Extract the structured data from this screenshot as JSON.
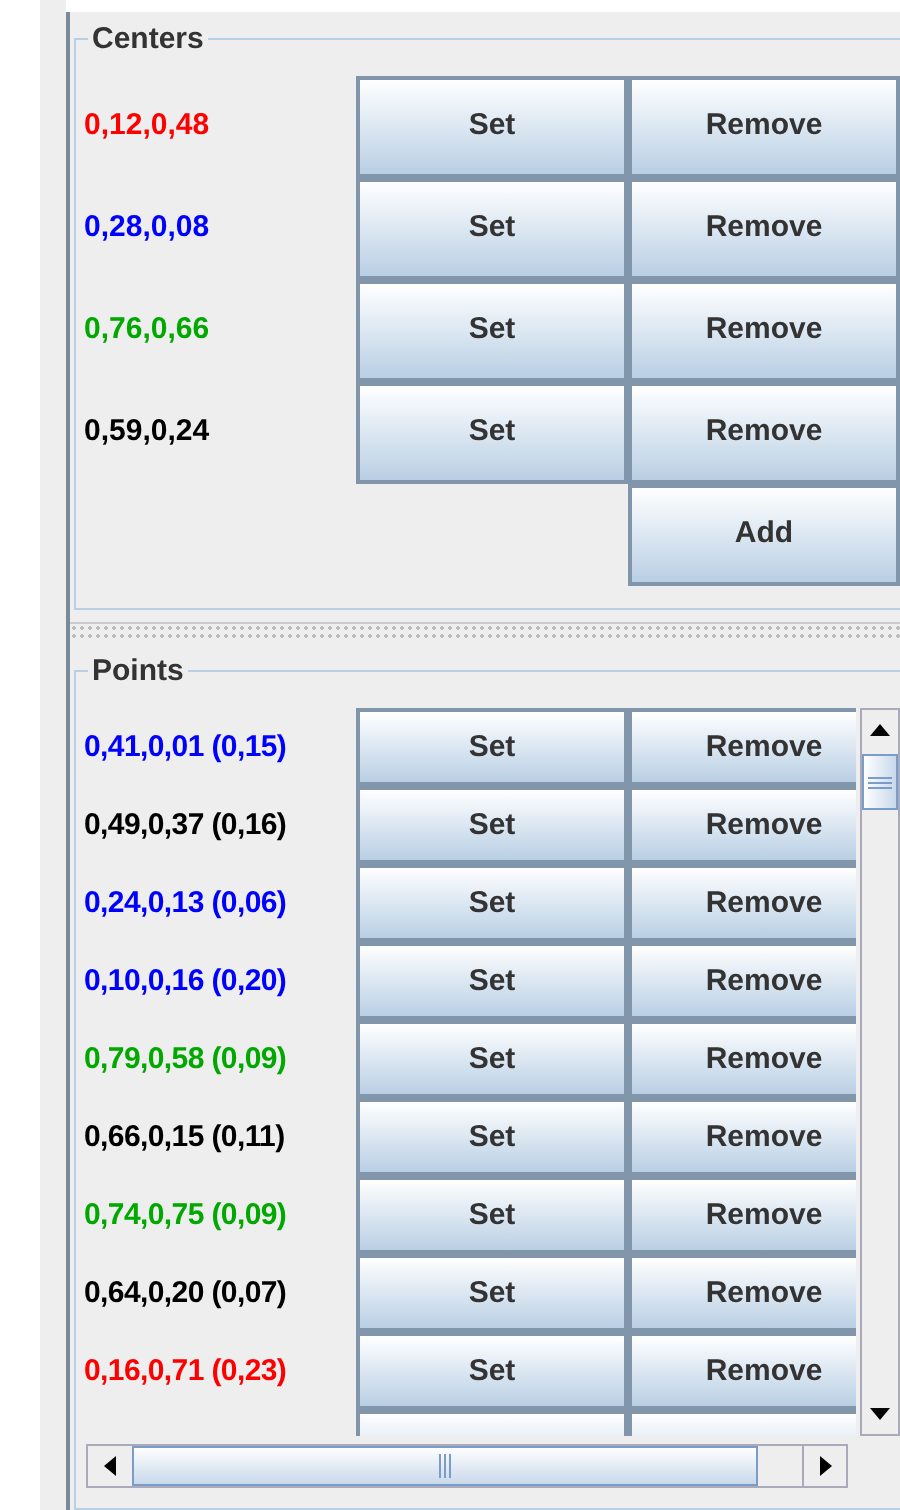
{
  "centers": {
    "title": "Centers",
    "items": [
      {
        "label": "0,12,0,48",
        "color": "#ff0000",
        "set": "Set",
        "remove": "Remove"
      },
      {
        "label": "0,28,0,08",
        "color": "#0000ff",
        "set": "Set",
        "remove": "Remove"
      },
      {
        "label": "0,76,0,66",
        "color": "#00a800",
        "set": "Set",
        "remove": "Remove"
      },
      {
        "label": "0,59,0,24",
        "color": "#000000",
        "set": "Set",
        "remove": "Remove"
      }
    ],
    "add": "Add"
  },
  "points": {
    "title": "Points",
    "items": [
      {
        "label": "0,41,0,01 (0,15)",
        "color": "#0000ff",
        "set": "Set",
        "remove": "Remove"
      },
      {
        "label": "0,49,0,37 (0,16)",
        "color": "#000000",
        "set": "Set",
        "remove": "Remove"
      },
      {
        "label": "0,24,0,13 (0,06)",
        "color": "#0000ff",
        "set": "Set",
        "remove": "Remove"
      },
      {
        "label": "0,10,0,16 (0,20)",
        "color": "#0000ff",
        "set": "Set",
        "remove": "Remove"
      },
      {
        "label": "0,79,0,58 (0,09)",
        "color": "#00a800",
        "set": "Set",
        "remove": "Remove"
      },
      {
        "label": "0,66,0,15 (0,11)",
        "color": "#000000",
        "set": "Set",
        "remove": "Remove"
      },
      {
        "label": "0,74,0,75 (0,09)",
        "color": "#00a800",
        "set": "Set",
        "remove": "Remove"
      },
      {
        "label": "0,64,0,20 (0,07)",
        "color": "#000000",
        "set": "Set",
        "remove": "Remove"
      },
      {
        "label": "0,16,0,71 (0,23)",
        "color": "#ff0000",
        "set": "Set",
        "remove": "Remove"
      }
    ]
  }
}
